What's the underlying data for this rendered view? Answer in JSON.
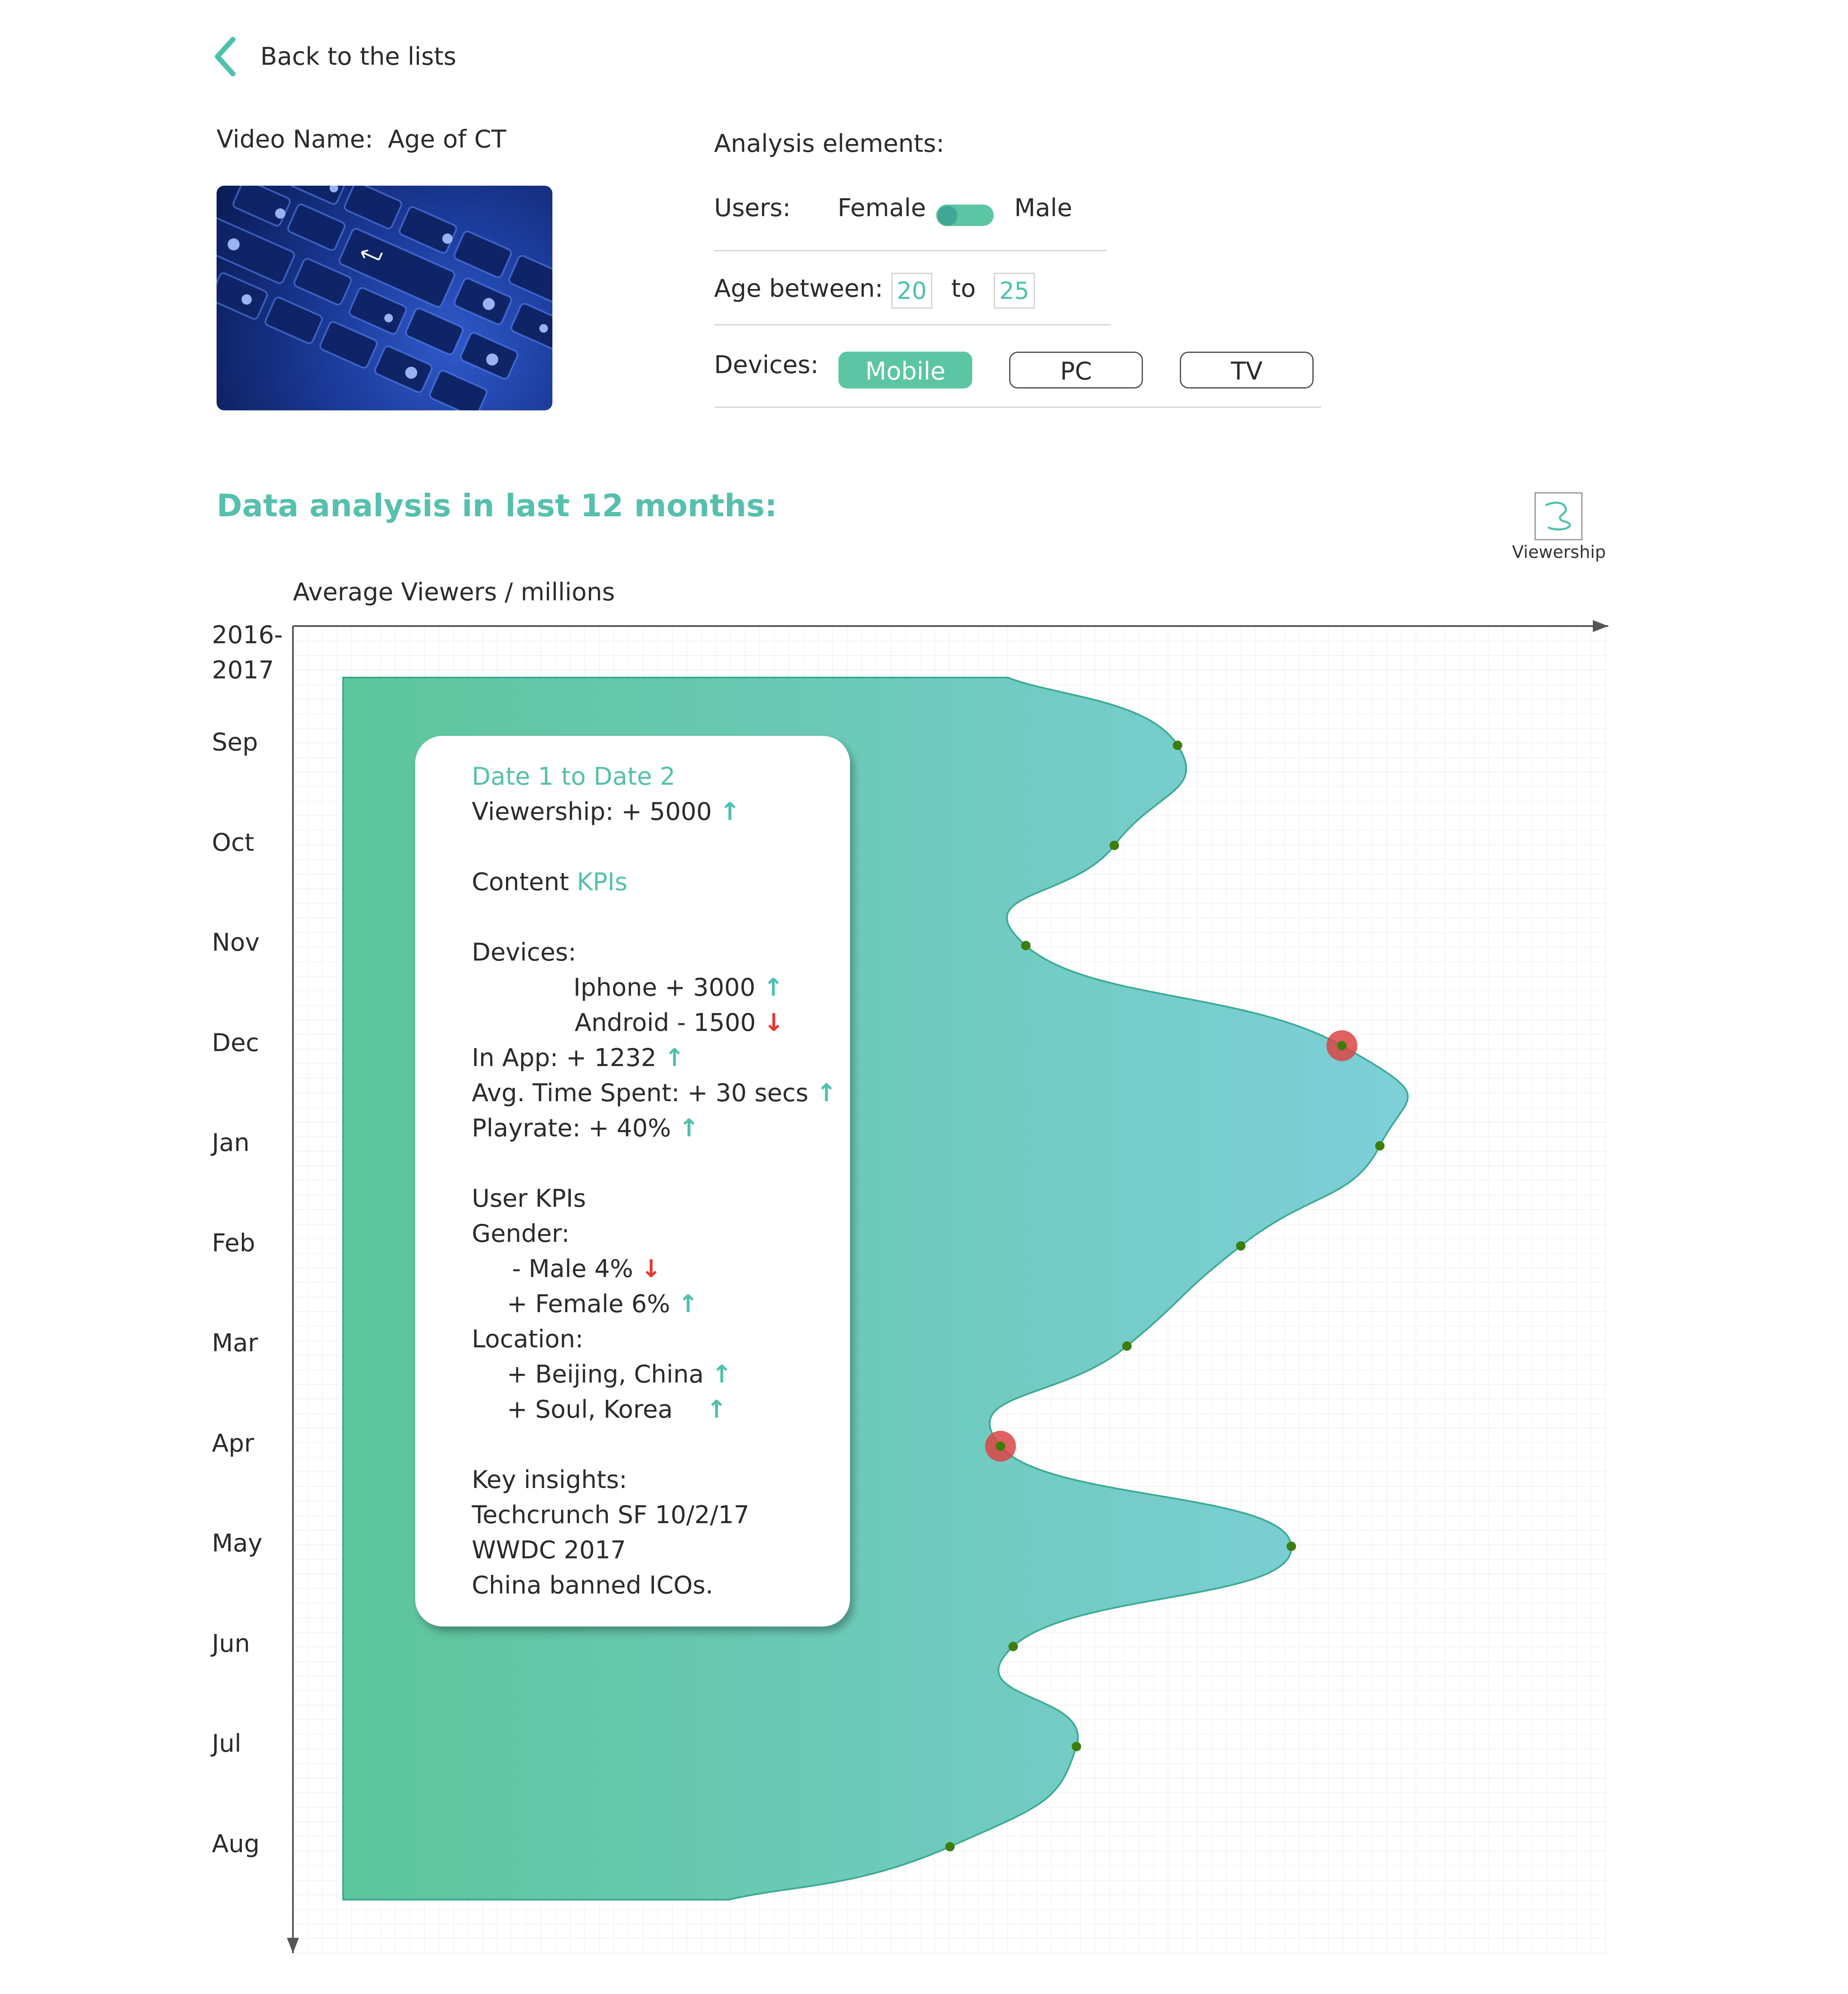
{
  "header": {
    "back_label": "Back to the lists",
    "video_name_label": "Video Name:",
    "video_name_value": "Age of CT"
  },
  "analysis": {
    "title": "Analysis elements:",
    "users_label": "Users:",
    "female_label": "Female",
    "male_label": "Male",
    "age_label": "Age between:",
    "age_from": "20",
    "age_to_word": "to",
    "age_to": "25",
    "devices_label": "Devices:",
    "devices": [
      {
        "label": "Mobile",
        "active": true
      },
      {
        "label": "PC",
        "active": false
      },
      {
        "label": "TV",
        "active": false
      }
    ]
  },
  "section_title": "Data analysis in last 12 months:",
  "viewership_icon_label": "Viewership",
  "colors": {
    "teal": "#56c0ad",
    "area_start": "#5cc59b",
    "area_end": "#7ecfd9",
    "point": "#3d7d0c",
    "highlight": "#d94545",
    "down_arrow": "#e53935"
  },
  "chart_data": {
    "type": "area",
    "orientation": "vertical-time-axis",
    "x_axis_label": "Average Viewers / millions",
    "period_label": [
      "2016-",
      "2017"
    ],
    "categories": [
      "Sep",
      "Oct",
      "Nov",
      "Dec",
      "Jan",
      "Feb",
      "Mar",
      "Apr",
      "May",
      "Jun",
      "Jul",
      "Aug"
    ],
    "values": [
      0.66,
      0.61,
      0.54,
      0.79,
      0.82,
      0.71,
      0.62,
      0.52,
      0.75,
      0.53,
      0.58,
      0.48
    ],
    "highlighted": [
      "Dec",
      "Apr"
    ],
    "grid": true
  },
  "card": {
    "date_range": "Date 1 to Date 2",
    "viewership": "Viewership: + 5000",
    "content_prefix": "Content",
    "content_kpis": "KPIs",
    "devices": "Devices:",
    "iphone": "Iphone   + 3000",
    "android": "Android  - 1500",
    "in_app": "In App: + 1232",
    "avg_time": "Avg. Time Spent: + 30 secs",
    "playrate": "Playrate: + 40%",
    "user_kpis": "User KPIs",
    "gender": "Gender:",
    "male": "- Male 4%",
    "female": "+ Female 6%",
    "location": "Location:",
    "beijing": "+ Beijing, China",
    "soul": "+ Soul, Korea",
    "key_insights": "Key insights:",
    "insight_1": "Techcrunch SF 10/2/17",
    "insight_2": "WWDC 2017",
    "insight_3": "China banned ICOs."
  }
}
